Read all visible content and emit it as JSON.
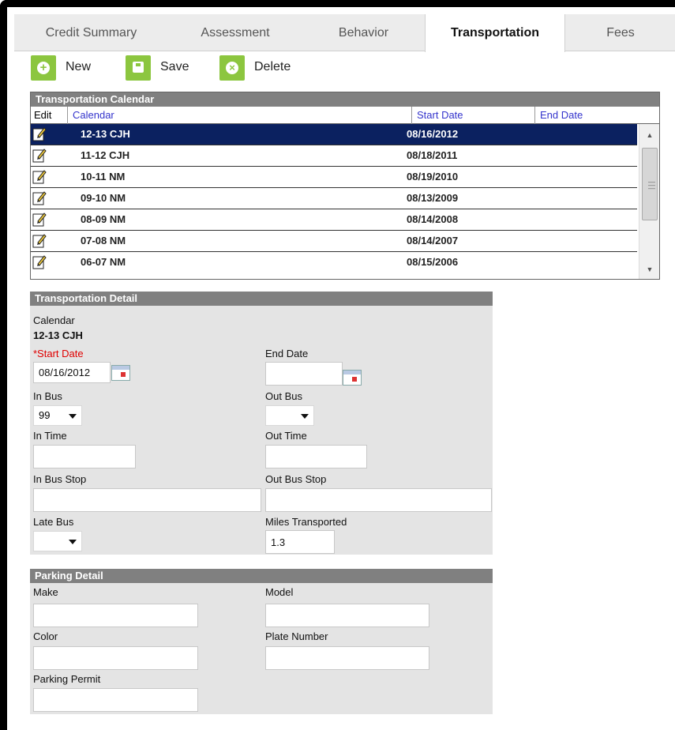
{
  "tabs": [
    {
      "label": "Credit Summary"
    },
    {
      "label": "Assessment"
    },
    {
      "label": "Behavior"
    },
    {
      "label": "Transportation",
      "active": true
    },
    {
      "label": "Fees"
    }
  ],
  "toolbar": {
    "new_label": "New",
    "save_label": "Save",
    "delete_label": "Delete",
    "new_icon": "plus-circle-icon",
    "save_icon": "floppy-disk-icon",
    "delete_icon": "x-circle-icon",
    "accent_color": "#8cc63f"
  },
  "calendar_grid": {
    "title": "Transportation Calendar",
    "columns": {
      "edit": "Edit",
      "calendar": "Calendar",
      "start_date": "Start Date",
      "end_date": "End Date"
    },
    "rows": [
      {
        "calendar": "12-13 CJH",
        "start_date": "08/16/2012",
        "end_date": "",
        "selected": true
      },
      {
        "calendar": "11-12 CJH",
        "start_date": "08/18/2011",
        "end_date": ""
      },
      {
        "calendar": "10-11 NM",
        "start_date": "08/19/2010",
        "end_date": ""
      },
      {
        "calendar": "09-10 NM",
        "start_date": "08/13/2009",
        "end_date": ""
      },
      {
        "calendar": "08-09 NM",
        "start_date": "08/14/2008",
        "end_date": ""
      },
      {
        "calendar": "07-08 NM",
        "start_date": "08/14/2007",
        "end_date": ""
      },
      {
        "calendar": "06-07 NM",
        "start_date": "08/15/2006",
        "end_date": ""
      }
    ],
    "selected_color": "#0b2160",
    "header_link_color": "#3333cc"
  },
  "detail": {
    "title": "Transportation Detail",
    "calendar_label": "Calendar",
    "calendar_value": "12-13 CJH",
    "start_date_label": "*Start Date",
    "start_date_value": "08/16/2012",
    "end_date_label": "End Date",
    "end_date_value": "",
    "in_bus_label": "In Bus",
    "in_bus_value": "99",
    "out_bus_label": "Out Bus",
    "out_bus_value": "",
    "in_time_label": "In Time",
    "in_time_value": "",
    "out_time_label": "Out Time",
    "out_time_value": "",
    "in_bus_stop_label": "In Bus Stop",
    "in_bus_stop_value": "",
    "out_bus_stop_label": "Out Bus Stop",
    "out_bus_stop_value": "",
    "late_bus_label": "Late Bus",
    "late_bus_value": "",
    "miles_label": "Miles Transported",
    "miles_value": "1.3"
  },
  "parking": {
    "title": "Parking Detail",
    "make_label": "Make",
    "model_label": "Model",
    "color_label": "Color",
    "plate_label": "Plate Number",
    "permit_label": "Parking Permit",
    "make_value": "",
    "model_value": "",
    "color_value": "",
    "plate_value": "",
    "permit_value": ""
  }
}
